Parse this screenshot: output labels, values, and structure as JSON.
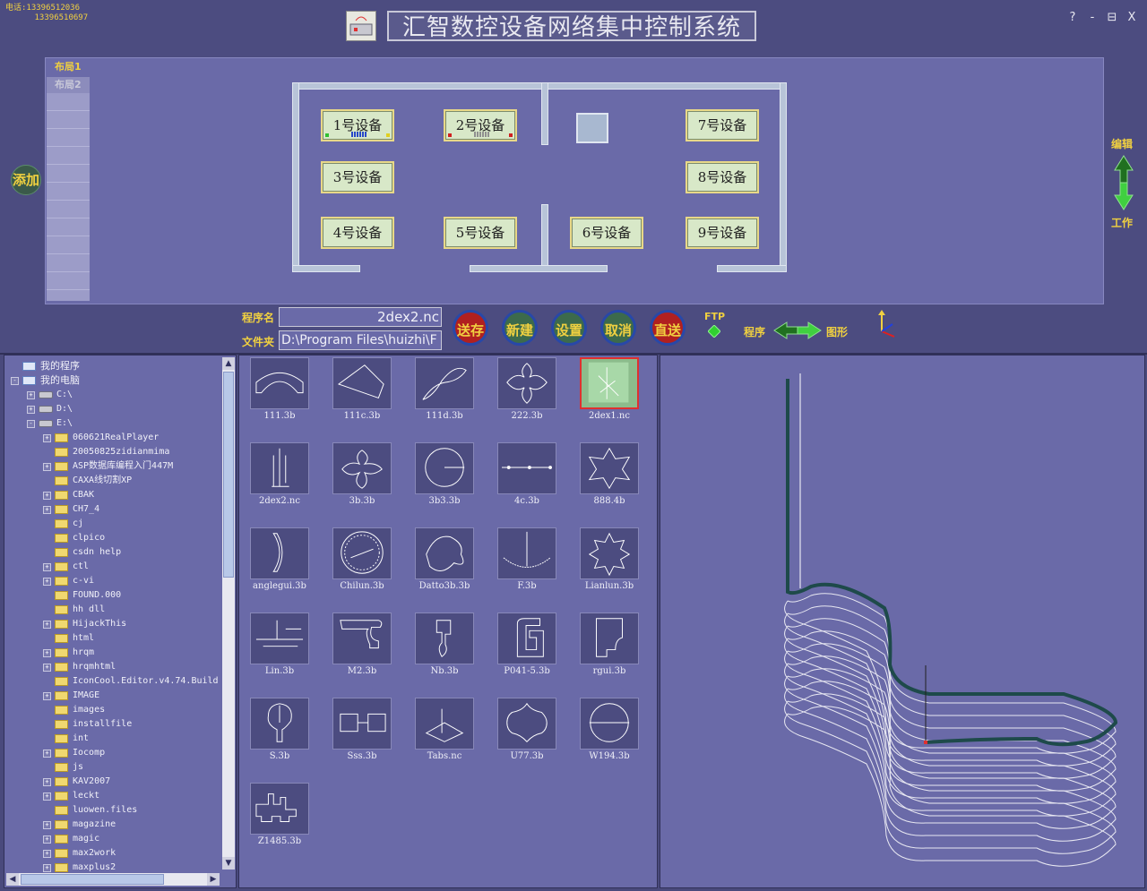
{
  "header": {
    "phone_line1": "电话:13396512036",
    "phone_line2": "13396510697",
    "title": "汇智数控设备网络集中控制系统",
    "help": "?",
    "minimize": "-",
    "restore": "⊟",
    "close": "X"
  },
  "layout": {
    "tab1": "布局1",
    "tab2": "布局2",
    "add": "添加",
    "devices": [
      "1号设备",
      "2号设备",
      "3号设备",
      "4号设备",
      "5号设备",
      "6号设备",
      "7号设备",
      "8号设备",
      "9号设备"
    ],
    "edit": "编辑",
    "work": "工作"
  },
  "program": {
    "name_label": "程序名",
    "name_value": "2dex2.nc",
    "folder_label": "文件夹",
    "folder_value": "D:\\Program Files\\huizhi\\F",
    "buttons": [
      "送存",
      "新建",
      "设置",
      "取消",
      "直送"
    ],
    "ftp": "FTP",
    "program_label": "程序",
    "graphic_label": "图形"
  },
  "tree": {
    "root": "我的程序",
    "computer": "我的电脑",
    "drives": [
      "C:\\",
      "D:\\",
      "E:\\"
    ],
    "folders": [
      "060621RealPlayer",
      "20050825zidianmima",
      "ASP数据库编程入门447M",
      "CAXA线切割XP",
      "CBAK",
      "CH7_4",
      "cj",
      "clpico",
      "csdn help",
      "ctl",
      "c-vi",
      "FOUND.000",
      "hh dll",
      "HijackThis",
      "html",
      "hrqm",
      "hrqmhtml",
      "IconCool.Editor.v4.74.Build",
      "IMAGE",
      "images",
      "installfile",
      "int",
      "Iocomp",
      "js",
      "KAV2007",
      "leckt",
      "luowen.files",
      "magazine",
      "magic",
      "max2work",
      "maxplus2"
    ]
  },
  "files": [
    "111.3b",
    "111c.3b",
    "111d.3b",
    "222.3b",
    "2dex1.nc",
    "2dex2.nc",
    "3b.3b",
    "3b3.3b",
    "4c.3b",
    "888.4b",
    "anglegui.3b",
    "Chilun.3b",
    "Datto3b.3b",
    "F.3b",
    "Lianlun.3b",
    "Lin.3b",
    "M2.3b",
    "Nb.3b",
    "P041-5.3b",
    "rgui.3b",
    "S.3b",
    "Sss.3b",
    "Tabs.nc",
    "U77.3b",
    "W194.3b",
    "Z1485.3b"
  ],
  "colors": {
    "accent_yellow": "#f0d040",
    "panel": "#6a6aa8",
    "background": "#4c4c80",
    "device_bg": "#d8e8c8"
  }
}
